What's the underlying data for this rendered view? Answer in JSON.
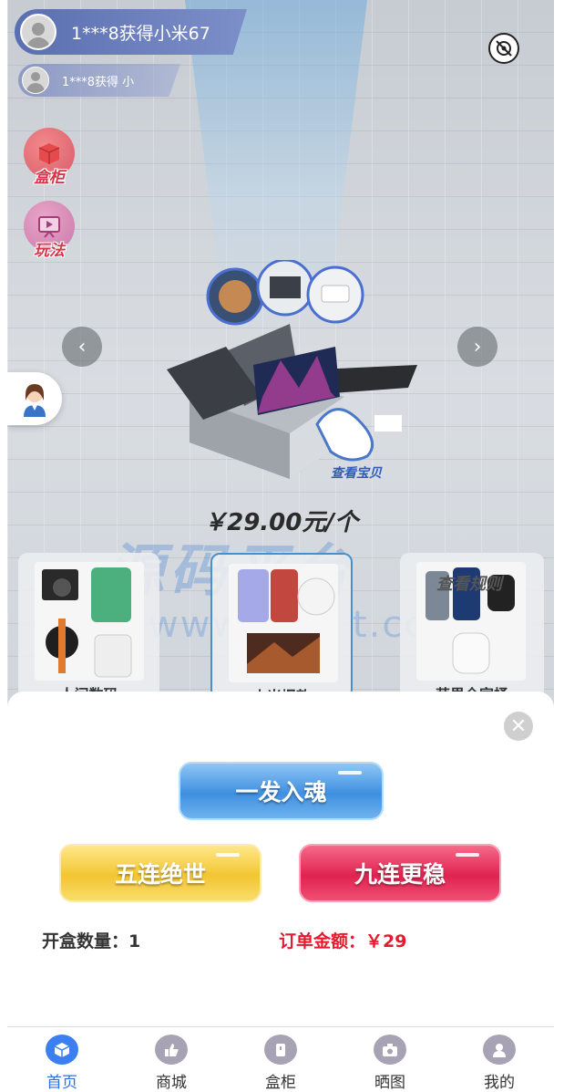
{
  "danmaku": [
    {
      "text": "1***8获得小米67"
    },
    {
      "text": "1***8获得 小"
    }
  ],
  "side_buttons": {
    "cabinet": "盒柜",
    "play": "玩法"
  },
  "hero": {
    "view_label": "查看宝贝",
    "price": "￥29.00元/个"
  },
  "watermark": {
    "line1": "源码平台",
    "line2": "www.ymp t.cc"
  },
  "cards": [
    {
      "title": "人间数码"
    },
    {
      "title": "小米爆款"
    },
    {
      "title": "苹果全家桶",
      "badge": "查看规则"
    }
  ],
  "sheet": {
    "btn_one": "一发入魂",
    "btn_five": "五连绝世",
    "btn_nine": "九连更稳",
    "qty_label": "开盒数量：",
    "qty_value": "1",
    "amount_label": "订单金额：",
    "amount_value": "￥29"
  },
  "tabbar": [
    {
      "label": "首页",
      "icon": "cube-icon",
      "active": true
    },
    {
      "label": "商城",
      "icon": "thumb-icon"
    },
    {
      "label": "盒柜",
      "icon": "box-icon"
    },
    {
      "label": "晒图",
      "icon": "camera-icon"
    },
    {
      "label": "我的",
      "icon": "user-icon"
    }
  ],
  "colors": {
    "accent": "#3b7ff0",
    "amount": "#e6192e"
  }
}
